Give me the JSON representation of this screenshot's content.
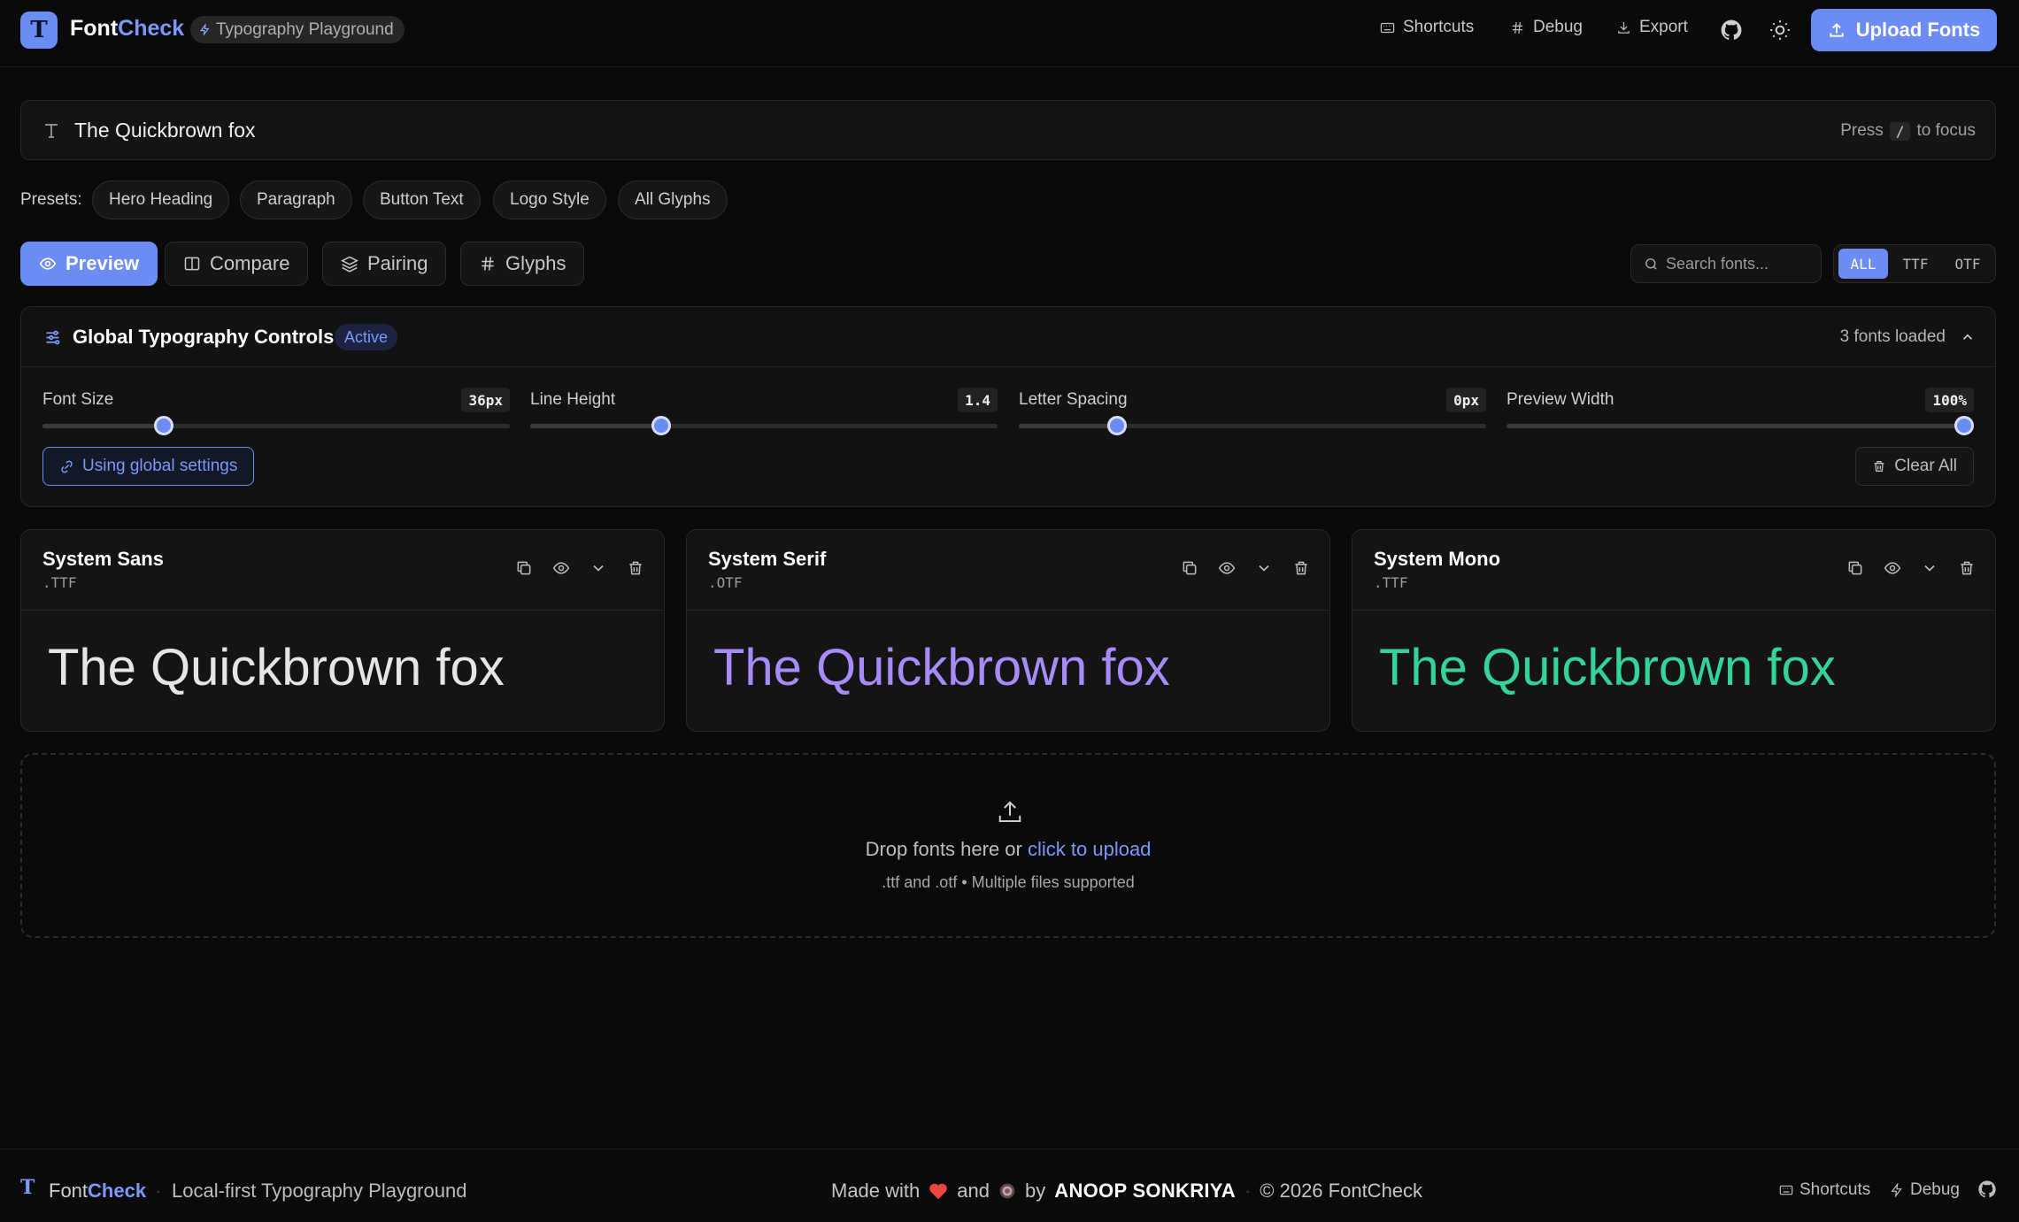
{
  "header": {
    "logo_letter": "T",
    "brand_prefix": "Font",
    "brand_accent": "Check",
    "tag": "Typography Playground",
    "links": {
      "shortcuts": "Shortcuts",
      "debug": "Debug",
      "export": "Export"
    },
    "upload_label": "Upload Fonts"
  },
  "text_input": {
    "value": "The Quickbrown fox",
    "hint_prefix": "Press",
    "hint_key": "/",
    "hint_suffix": "to focus"
  },
  "presets": {
    "label": "Presets:",
    "items": [
      "Hero Heading",
      "Paragraph",
      "Button Text",
      "Logo Style",
      "All Glyphs"
    ]
  },
  "tabs": [
    {
      "label": "Preview",
      "active": true,
      "icon": "eye-icon"
    },
    {
      "label": "Compare",
      "active": false,
      "icon": "columns-icon"
    },
    {
      "label": "Pairing",
      "active": false,
      "icon": "layers-icon"
    },
    {
      "label": "Glyphs",
      "active": false,
      "icon": "hash-icon"
    }
  ],
  "search": {
    "placeholder": "Search fonts..."
  },
  "filters": {
    "all": "ALL",
    "ttf": "TTF",
    "otf": "OTF",
    "selected": "ALL"
  },
  "controls": {
    "title": "Global Typography Controls",
    "badge": "Active",
    "loaded": "3 fonts loaded",
    "sliders": [
      {
        "label": "Font Size",
        "value": "36px",
        "level": 0.26
      },
      {
        "label": "Line Height",
        "value": "1.4",
        "level": 0.28
      },
      {
        "label": "Letter Spacing",
        "value": "0px",
        "level": 0.21
      },
      {
        "label": "Preview Width",
        "value": "100%",
        "level": 0.98
      }
    ],
    "global_label": "Using global settings",
    "clear_label": "Clear All"
  },
  "cards": [
    {
      "name": "System Sans",
      "ext": ".TTF",
      "sample": "The Quickbrown fox",
      "color": "#e5e5e5"
    },
    {
      "name": "System Serif",
      "ext": ".OTF",
      "sample": "The Quickbrown fox",
      "color": "#a78bfa"
    },
    {
      "name": "System Mono",
      "ext": ".TTF",
      "sample": "The Quickbrown fox",
      "color": "#34d399"
    }
  ],
  "dropzone": {
    "text": "Drop fonts here or",
    "link": "click to upload",
    "sub": ".ttf and .otf • Multiple files supported"
  },
  "footer": {
    "brand_prefix": "Font",
    "brand_accent": "Check",
    "separator": "·",
    "tagline": "Local-first Typography Playground",
    "made_with": "Made with",
    "and": "and",
    "by": "by",
    "author": "ANOOP SONKRIYA",
    "copyright": "© 2026 FontCheck",
    "shortcuts": "Shortcuts",
    "debug": "Debug"
  },
  "colors": {
    "accent": "#6b8cf5",
    "background": "#0a0a0a",
    "heart": "#ef4444"
  }
}
